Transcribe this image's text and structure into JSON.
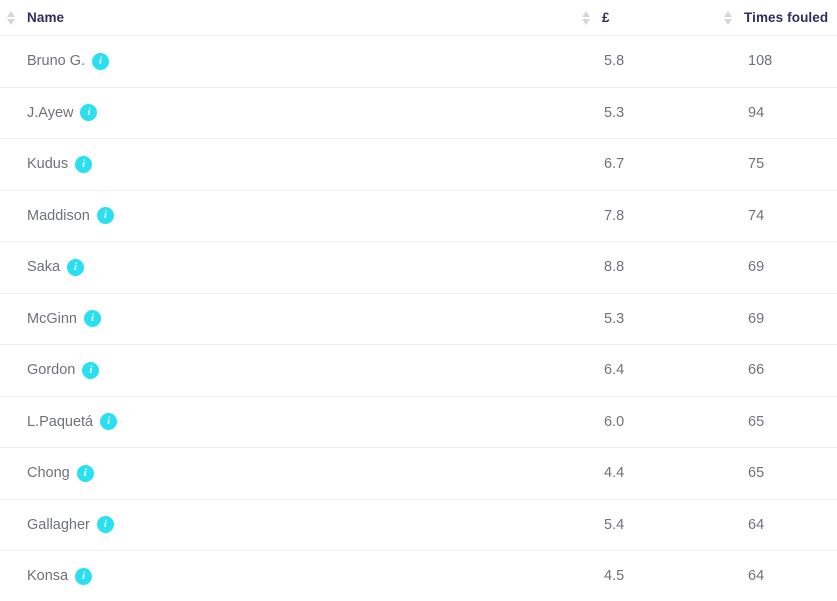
{
  "table": {
    "columns": [
      {
        "key": "name",
        "label": "Name",
        "sort_icon": "sort-updown-icon"
      },
      {
        "key": "price",
        "label": "£",
        "sort_icon": "sort-updown-icon"
      },
      {
        "key": "fouled",
        "label": "Times fouled",
        "sort_icon": "sort-updown-icon"
      }
    ],
    "row_info_icon": "info-icon",
    "row_info_glyph": "i",
    "rows": [
      {
        "name": "Bruno G.",
        "price": "5.8",
        "fouled": "108"
      },
      {
        "name": "J.Ayew",
        "price": "5.3",
        "fouled": "94"
      },
      {
        "name": "Kudus",
        "price": "6.7",
        "fouled": "75"
      },
      {
        "name": "Maddison",
        "price": "7.8",
        "fouled": "74"
      },
      {
        "name": "Saka",
        "price": "8.8",
        "fouled": "69"
      },
      {
        "name": "McGinn",
        "price": "5.3",
        "fouled": "69"
      },
      {
        "name": "Gordon",
        "price": "6.4",
        "fouled": "66"
      },
      {
        "name": "L.Paquetá",
        "price": "6.0",
        "fouled": "65"
      },
      {
        "name": "Chong",
        "price": "4.4",
        "fouled": "65"
      },
      {
        "name": "Gallagher",
        "price": "5.4",
        "fouled": "64"
      },
      {
        "name": "Konsa",
        "price": "4.5",
        "fouled": "64"
      }
    ]
  },
  "colors": {
    "header_text": "#2D2E5F",
    "body_text": "#6E7279",
    "divider": "#EEEFF2",
    "info_badge": "#29E0F2",
    "sort_icon": "#D5D7DE",
    "background": "#FFFFFF"
  }
}
